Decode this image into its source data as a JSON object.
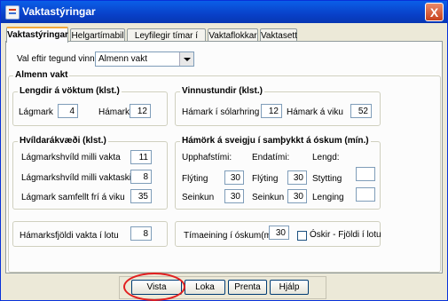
{
  "window": {
    "title": "Vaktastýringar",
    "close_label": "X"
  },
  "tabs": [
    "Vaktastýringar",
    "Helgartímabil",
    "Leyfilegir tímar í öskum",
    "Vaktaflokkar",
    "Vaktasett"
  ],
  "shift_select": {
    "label": "Val eftir tegund vinnu",
    "value": "Almenn vakt"
  },
  "section_title": "Almenn vakt",
  "shift_length": {
    "title": "Lengdir á vöktum (klst.)",
    "min_label": "Lágmark",
    "min_value": "4",
    "max_label": "Hámark",
    "max_value": "12"
  },
  "work_hours": {
    "title": "Vinnustundir (klst.)",
    "day_label": "Hámark í sólarhring",
    "day_value": "12",
    "week_label": "Hámark á viku",
    "week_value": "52"
  },
  "rest": {
    "title": "Hvíldarákvæði (klst.)",
    "between_shifts_label": "Lágmarkshvíld milli vakta",
    "between_shifts_value": "11",
    "shift_change_label": "Lágmarkshvíld milli vaktaskipta",
    "shift_change_value": "8",
    "weekly_label": "Lágmark samfellt frí  á viku",
    "weekly_value": "35"
  },
  "constraints": {
    "title": "Hámörk á sveigju í samþykkt á óskum (mín.)",
    "start_head": "Upphafstími:",
    "end_head": "Endatími:",
    "length_head": "Lengd:",
    "move_label": "Flýting",
    "delay_label": "Seinkun",
    "start_move": "30",
    "start_delay": "30",
    "end_move": "30",
    "end_delay": "30",
    "shorten_label": "Stytting",
    "extend_label": "Lenging",
    "shorten_value": "",
    "extend_value": ""
  },
  "max_shifts": {
    "label": "Hámarksfjöldi vakta í lotu",
    "value": "8"
  },
  "time_unit": {
    "label": "Tímaeining í óskum(mín)",
    "value": "30",
    "checkbox_label": "Óskir - Fjöldi í lotu"
  },
  "buttons": {
    "save": "Vista",
    "close": "Loka",
    "print": "Prenta",
    "help": "Hjálp"
  },
  "colors": {
    "titlebar": "#0a5fe8",
    "highlight_ring": "#e21f1f",
    "tab_accent": "#f2a83c"
  }
}
